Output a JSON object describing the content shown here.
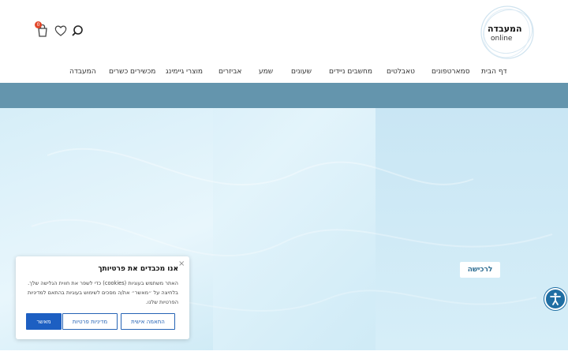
{
  "brand": {
    "title": "המעבדה",
    "subtitle": "online"
  },
  "header": {
    "cart_count": "0"
  },
  "nav": [
    {
      "label": "דף הבית"
    },
    {
      "label": "סמארטפונים"
    },
    {
      "label": "טאבלטים"
    },
    {
      "label": "מחשבים ניידים"
    },
    {
      "label": "שעונים"
    },
    {
      "label": "שמע"
    },
    {
      "label": "אביזרים"
    },
    {
      "label": "מוצרי גיימינג"
    },
    {
      "label": "מכשירים כשרים"
    },
    {
      "label": "המעבדה"
    }
  ],
  "hero": {
    "cta_label": "לרכישה"
  },
  "consent": {
    "close": "×",
    "title": "אנו מכבדים את פרטיותך",
    "text": "האתר משתמש בעוגיות (cookies) כדי לשפר את חווית הגלישה שלך. בלחיצה על ״מאשר״ את/ה מסכים לשימוש בעוגיות בהתאם למדיניות הפרטיות שלנו.",
    "btn_customize": "התאמה אישית",
    "btn_privacy": "מדיניות פרטיות",
    "btn_accept": "מאשר"
  },
  "colors": {
    "band": "#6495ad",
    "accent": "#1d5fc2",
    "badge": "#e2472a"
  },
  "icons": {
    "search": "search-icon",
    "wishlist": "heart-icon",
    "cart": "cart-icon",
    "accessibility": "accessibility-icon"
  }
}
